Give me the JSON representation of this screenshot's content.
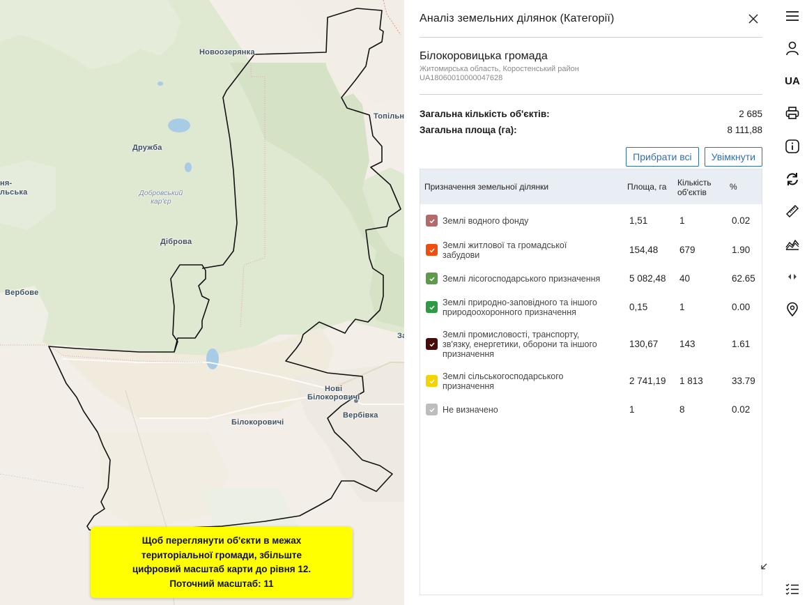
{
  "map": {
    "labels": {
      "novoozeryanka": "Новоозерянка",
      "topilnia": "Топільн",
      "druzhba": "Дружба",
      "dobrovskyi": "Добровський кар'єр",
      "dibrova": "Діброва",
      "verbove": "Вербове",
      "left_edge_1": "ня-",
      "left_edge_2": "льська",
      "nowi_1": "Нові",
      "nowi_2": "Білокоровичі",
      "verbivka": "Вербівка",
      "bilokorovychi": "Білокоровичі",
      "right_edge": "За"
    },
    "zoom_notice": {
      "line1": "Щоб переглянути об'єкти в межах",
      "line2": "територіальної громади, збільште",
      "line3": "цифровий масштаб карти до рівня 12.",
      "line4": "Поточний масштаб: 11"
    }
  },
  "panel": {
    "title": "Аналіз земельних ділянок (Категорії)",
    "community": {
      "name": "Білокоровицька громада",
      "region": "Житомирська область, Коростенський район",
      "code": "UA18060010000047628"
    },
    "totals": {
      "count_label": "Загальна кількість об'єктів:",
      "count_value": "2 685",
      "area_label": "Загальна площа (га):",
      "area_value": "8 111,88"
    },
    "buttons": {
      "remove_all": "Прибрати всі",
      "enable": "Увімкнути"
    },
    "table": {
      "headers": {
        "purpose": "Призначення земельної ділянки",
        "area": "Площа, га",
        "count_1": "Кількість",
        "count_2": "об'єктів",
        "percent": "%"
      },
      "rows": [
        {
          "category_1": "Землі водного фонду",
          "category_2": "",
          "category_3": "",
          "area": "1,51",
          "count": "1",
          "percent": "0.02",
          "color": "#b36a6a"
        },
        {
          "category_1": "Землі житлової та громадської",
          "category_2": "забудови",
          "category_3": "",
          "area": "154,48",
          "count": "679",
          "percent": "1.90",
          "color": "#f04e10"
        },
        {
          "category_1": "Землі лісогосподарського призначення",
          "category_2": "",
          "category_3": "",
          "area": "5 082,48",
          "count": "40",
          "percent": "62.65",
          "color": "#5d9a49"
        },
        {
          "category_1": "Землі природно-заповідного та іншого",
          "category_2": "природоохоронного призначення",
          "category_3": "",
          "area": "0,15",
          "count": "1",
          "percent": "0.00",
          "color": "#2e9a44"
        },
        {
          "category_1": "Землі промисловості, транспорту,",
          "category_2": "зв'язку, енергетики, оборони та іншого",
          "category_3": "призначення",
          "area": "130,67",
          "count": "143",
          "percent": "1.61",
          "color": "#4a0a0a"
        },
        {
          "category_1": "Землі сільськогосподарського",
          "category_2": "призначення",
          "category_3": "",
          "area": "2 741,19",
          "count": "1 813",
          "percent": "33.79",
          "color": "#f5d300"
        },
        {
          "category_1": "Не визначено",
          "category_2": "",
          "category_3": "",
          "area": "1",
          "count": "8",
          "percent": "0.02",
          "color": "#bdbdbd"
        }
      ]
    }
  },
  "toolbar": {
    "language": "UA"
  }
}
